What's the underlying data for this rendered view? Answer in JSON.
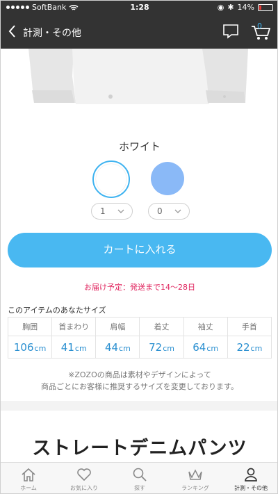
{
  "status_bar": {
    "carrier": "SoftBank",
    "time": "1:28",
    "battery": "14%"
  },
  "header": {
    "title": "計測・その他",
    "cart_count": "0"
  },
  "product": {
    "color_name": "ホワイト",
    "colors": [
      {
        "name": "white",
        "hex": "#ffffff",
        "selected": true,
        "qty": "1"
      },
      {
        "name": "blue",
        "hex": "#8ab9f7",
        "selected": false,
        "qty": "0"
      }
    ],
    "add_to_cart": "カートに入れる",
    "delivery": "お届け予定：発送まで14〜28日"
  },
  "size": {
    "title": "このアイテムのあなたサイズ",
    "unit": "cm",
    "columns": [
      "胸囲",
      "首まわり",
      "肩幅",
      "着丈",
      "袖丈",
      "手首"
    ],
    "values": [
      "106",
      "41",
      "44",
      "72",
      "64",
      "22"
    ]
  },
  "note": {
    "line1": "※ZOZOの商品は素材やデザインによって",
    "line2": "商品ごとにお客様に推奨するサイズを変更しております。"
  },
  "next_product": {
    "title": "ストレートデニムパンツ"
  },
  "tabbar": {
    "items": [
      {
        "label": "ホーム",
        "icon": "home-icon"
      },
      {
        "label": "お気に入り",
        "icon": "heart-icon"
      },
      {
        "label": "探す",
        "icon": "search-icon"
      },
      {
        "label": "ランキング",
        "icon": "crown-icon"
      },
      {
        "label": "計測・その他",
        "icon": "person-icon",
        "active": true
      }
    ]
  },
  "colors": {
    "accent": "#49b8f1",
    "header": "#333333",
    "delivery": "#e0245e"
  }
}
